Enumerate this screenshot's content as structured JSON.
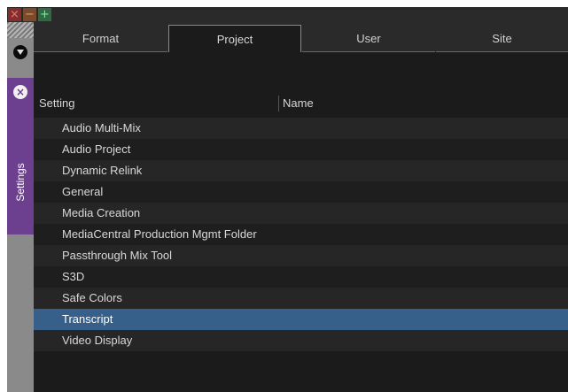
{
  "window": {
    "close_glyph": "×",
    "minimize_glyph": "−",
    "maximize_glyph": "+"
  },
  "sidebar": {
    "settings_label": "Settings",
    "close_glyph": "×"
  },
  "tabs": [
    {
      "label": "Format",
      "active": false
    },
    {
      "label": "Project",
      "active": true
    },
    {
      "label": "User",
      "active": false
    },
    {
      "label": "Site",
      "active": false
    }
  ],
  "table": {
    "columns": [
      "Setting",
      "Name"
    ],
    "rows": [
      {
        "setting": "Audio Multi-Mix",
        "name": ""
      },
      {
        "setting": "Audio Project",
        "name": ""
      },
      {
        "setting": "Dynamic Relink",
        "name": ""
      },
      {
        "setting": "General",
        "name": ""
      },
      {
        "setting": "Media Creation",
        "name": ""
      },
      {
        "setting": "MediaCentral Production Mgmt Folder",
        "name": ""
      },
      {
        "setting": "Passthrough Mix Tool",
        "name": ""
      },
      {
        "setting": "S3D",
        "name": ""
      },
      {
        "setting": "Safe Colors",
        "name": ""
      },
      {
        "setting": "Transcript",
        "name": "",
        "selected": true
      },
      {
        "setting": "Video Display",
        "name": ""
      }
    ]
  },
  "colors": {
    "selected_row": "#365f8a",
    "sidebar_accent": "#6d3f8f"
  }
}
